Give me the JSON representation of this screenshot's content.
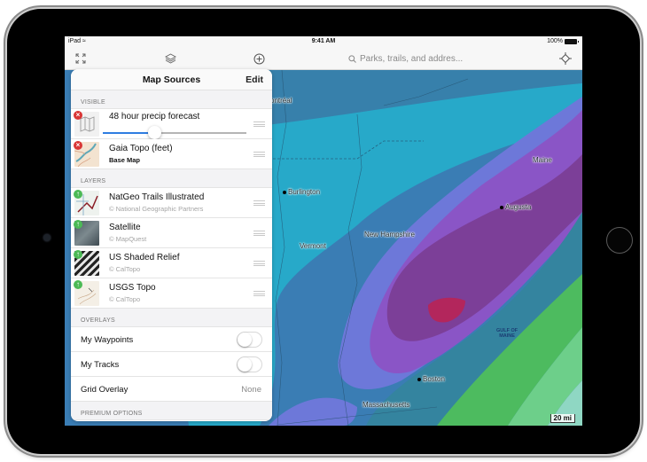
{
  "device": {
    "name": "iPad"
  },
  "statusbar": {
    "carrier": "iPad",
    "time": "9:41 AM",
    "battery": "100%"
  },
  "toolbar": {
    "icons": [
      "expand-icon",
      "layers-icon",
      "add-icon",
      "locate-icon"
    ],
    "search_placeholder": "Parks, trails, and addres..."
  },
  "panel": {
    "title": "Map Sources",
    "edit_label": "Edit",
    "sections": {
      "visible": "VISIBLE",
      "layers": "LAYERS",
      "overlays": "OVERLAYS",
      "premium": "PREMIUM OPTIONS"
    },
    "visible": [
      {
        "name": "48 hour precip forecast",
        "opacity": 0.36,
        "action": "remove"
      },
      {
        "name": "Gaia Topo (feet)",
        "subtitle": "Base Map",
        "action": "remove"
      }
    ],
    "layers": [
      {
        "name": "NatGeo Trails Illustrated",
        "subtitle": "© National Geographic Partners",
        "action": "add"
      },
      {
        "name": "Satellite",
        "subtitle": "© MapQuest",
        "action": "add"
      },
      {
        "name": "US Shaded Relief",
        "subtitle": "© CalTopo",
        "action": "add"
      },
      {
        "name": "USGS Topo",
        "subtitle": "© CalTopo",
        "action": "add"
      }
    ],
    "overlays": [
      {
        "name": "My Waypoints",
        "enabled": false
      },
      {
        "name": "My Tracks",
        "enabled": false
      },
      {
        "name": "Grid Overlay",
        "value": "None"
      }
    ]
  },
  "map": {
    "labels": {
      "montreal": "ontréal",
      "burlington": "Burlington",
      "maine": "Maine",
      "augusta": "Augusta",
      "vermont": "Vermont",
      "new_hampshire": "New Hampshire",
      "gulf_of_maine_1": "GULF OF",
      "gulf_of_maine_2": "MAINE",
      "boston": "Boston",
      "massachusetts": "Massachusetts"
    },
    "scale": "20 mi",
    "colors": {
      "deep_blue": "#3a7db4",
      "cyan": "#27a9c9",
      "periwinkle": "#6d78d9",
      "violet": "#8a55c6",
      "plum": "#7c3f98",
      "magenta": "#b3265c",
      "teal": "#34849f",
      "green": "#4dbb5f",
      "light_green": "#6dcf8a",
      "mint": "#8fd7c3"
    }
  }
}
